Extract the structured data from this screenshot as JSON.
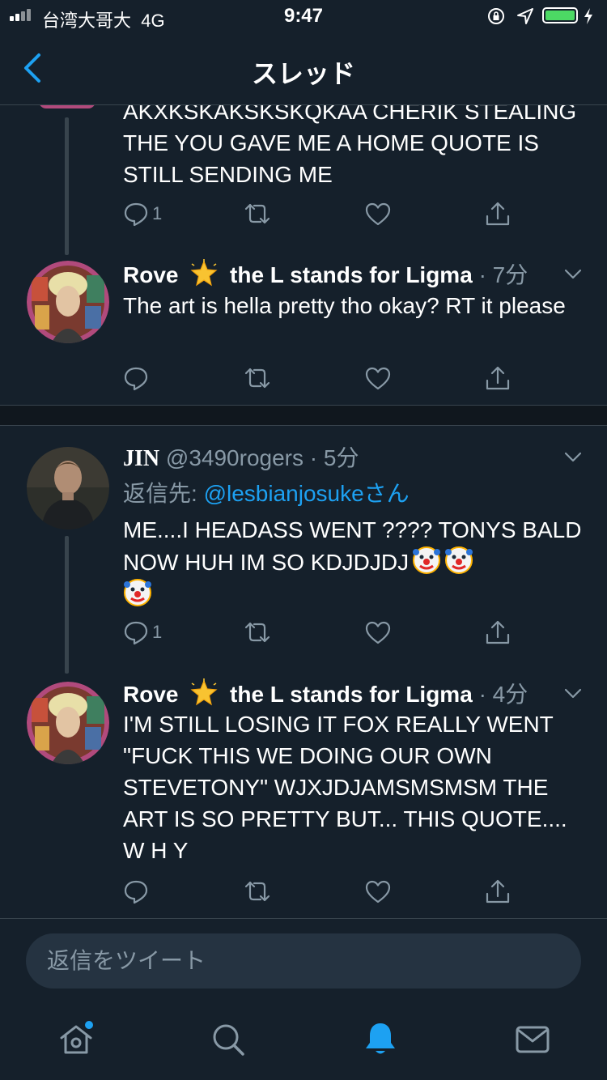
{
  "status_bar": {
    "carrier": "台湾大哥大",
    "network": "4G",
    "time": "9:47"
  },
  "header": {
    "title": "スレッド",
    "back_icon": "chevron-left-icon"
  },
  "tweets": [
    {
      "text": "AKXKSKAKSKSKQKAA CHERIK STEALING THE YOU GAVE ME A HOME QUOTE IS STILL SENDING ME",
      "reply_count": "1"
    },
    {
      "name": "Rove",
      "name_suffix": "the L stands for Ligma",
      "time": "· 7分",
      "text": "The art is hella pretty tho okay? RT it please"
    },
    {
      "name": "JIN",
      "handle": "@3490rogers",
      "time": "· 5分",
      "reply_prefix": "返信先: ",
      "reply_to": "@lesbianjosuke",
      "reply_suffix": "さん",
      "text": "ME....I HEADASS WENT ???? TONYS BALD NOW HUH IM SO KDJDJDJ",
      "reply_count": "1"
    },
    {
      "name": "Rove",
      "name_suffix": "the L stands for Ligma",
      "time": "· 4分",
      "text": "I'M STILL LOSING IT FOX REALLY WENT \"FUCK THIS WE DOING OUR OWN STEVETONY\" WJXJDJAMSMSMSM THE ART IS SO PRETTY BUT... THIS QUOTE.... W H Y"
    }
  ],
  "reply_bar": {
    "placeholder": "返信をツイート"
  },
  "tab_bar": {
    "items": [
      "home-icon",
      "search-icon",
      "notifications-icon",
      "messages-icon"
    ],
    "active": "notifications-icon"
  },
  "colors": {
    "background": "#15202b",
    "accent": "#1da1f2",
    "secondary_text": "#8899a6",
    "divider": "#38444d",
    "battery": "#4cd964"
  }
}
